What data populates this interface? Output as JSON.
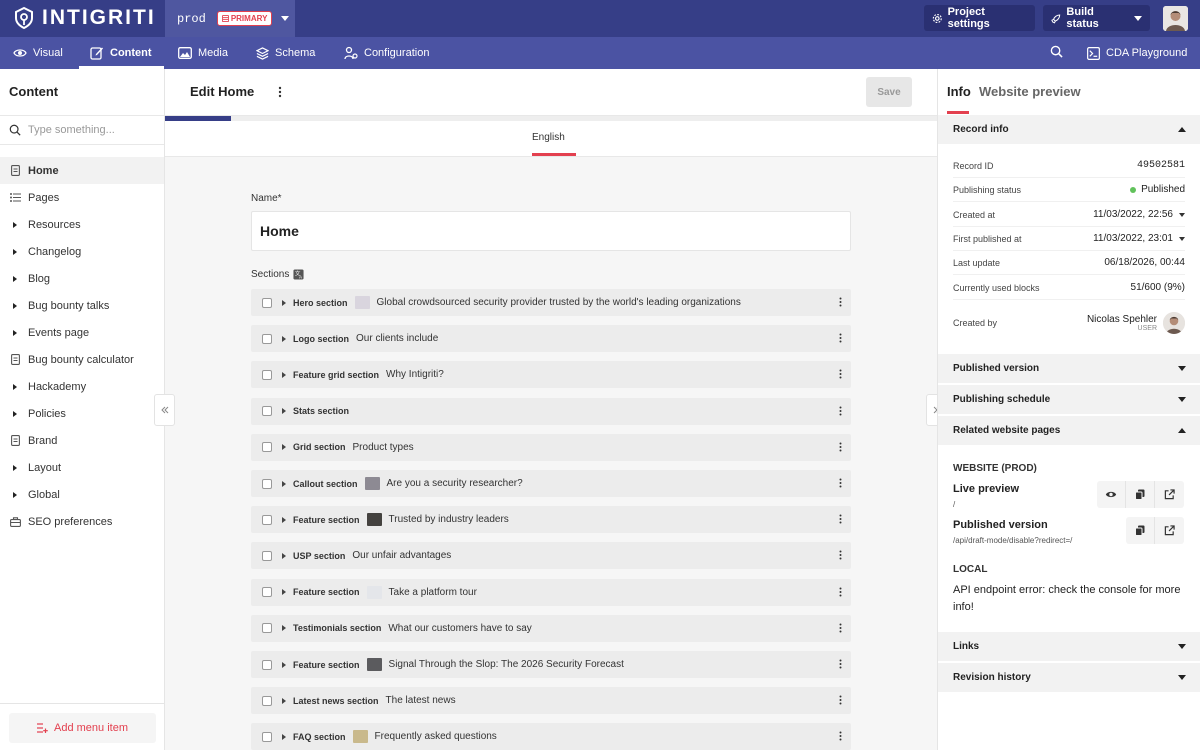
{
  "brand": {
    "name": "INTIGRITI"
  },
  "environment": {
    "name": "prod",
    "badge": "PRIMARY"
  },
  "top_actions": {
    "project_settings": "Project settings",
    "build_status": "Build status"
  },
  "nav": {
    "items": [
      {
        "label": "Visual"
      },
      {
        "label": "Content"
      },
      {
        "label": "Media"
      },
      {
        "label": "Schema"
      },
      {
        "label": "Configuration"
      }
    ],
    "active": "Content",
    "cda_playground": "CDA Playground"
  },
  "sidebar": {
    "title": "Content",
    "search_placeholder": "Type something...",
    "items": [
      {
        "label": "Home",
        "icon": "document-icon"
      },
      {
        "label": "Pages",
        "icon": "list-icon"
      },
      {
        "label": "Resources",
        "icon": "expand-icon"
      },
      {
        "label": "Changelog",
        "icon": "expand-icon"
      },
      {
        "label": "Blog",
        "icon": "expand-icon"
      },
      {
        "label": "Bug bounty talks",
        "icon": "expand-icon"
      },
      {
        "label": "Events page",
        "icon": "expand-icon"
      },
      {
        "label": "Bug bounty calculator",
        "icon": "document-icon"
      },
      {
        "label": "Hackademy",
        "icon": "expand-icon"
      },
      {
        "label": "Policies",
        "icon": "expand-icon"
      },
      {
        "label": "Brand",
        "icon": "document-icon"
      },
      {
        "label": "Layout",
        "icon": "expand-icon"
      },
      {
        "label": "Global",
        "icon": "expand-icon"
      },
      {
        "label": "SEO preferences",
        "icon": "tools-icon"
      }
    ],
    "add_menu_item": "Add menu item"
  },
  "editor": {
    "title": "Edit Home",
    "save": "Save",
    "progress": 0.085,
    "language_tab": "English",
    "name_label": "Name*",
    "name_value": "Home",
    "sections_label": "Sections",
    "sections": [
      {
        "type": "Hero section",
        "title": "Global crowdsourced security provider trusted by the world's leading organizations",
        "thumb": "#d9d5de"
      },
      {
        "type": "Logo section",
        "title": "Our clients include",
        "thumb": ""
      },
      {
        "type": "Feature grid section",
        "title": "Why Intigriti?",
        "thumb": ""
      },
      {
        "type": "Stats section",
        "title": "",
        "thumb": ""
      },
      {
        "type": "Grid section",
        "title": "Product types",
        "thumb": ""
      },
      {
        "type": "Callout section",
        "title": "Are you a security researcher?",
        "thumb": "#8d8a93"
      },
      {
        "type": "Feature section",
        "title": "Trusted by industry leaders",
        "thumb": "#44423f"
      },
      {
        "type": "USP section",
        "title": "Our unfair advantages",
        "thumb": ""
      },
      {
        "type": "Feature section",
        "title": "Take a platform tour",
        "thumb": "#e4e6ea"
      },
      {
        "type": "Testimonials section",
        "title": "What our customers have to say",
        "thumb": ""
      },
      {
        "type": "Feature section",
        "title": "Signal Through the Slop: The 2026 Security Forecast",
        "thumb": "#5b5b5e"
      },
      {
        "type": "Latest news section",
        "title": "The latest news",
        "thumb": ""
      },
      {
        "type": "FAQ section",
        "title": "Frequently asked questions",
        "thumb": "#c9b98c"
      }
    ]
  },
  "info_panel": {
    "tab_info": "Info",
    "tab_preview": "Website preview",
    "record_info": "Record info",
    "rows": [
      {
        "label": "Record ID",
        "value": "49502581"
      },
      {
        "label": "Publishing status",
        "value": "Published"
      },
      {
        "label": "Created at",
        "value": "11/03/2022, 22:56"
      },
      {
        "label": "First published at",
        "value": "11/03/2022, 23:01"
      },
      {
        "label": "Last update",
        "value": "06/18/2026, 00:44"
      },
      {
        "label": "Currently used blocks",
        "value": "51/600 (9%)"
      },
      {
        "label": "Created by",
        "value": "Nicolas Spehler",
        "role": "USER"
      }
    ],
    "published_version": "Published version",
    "publishing_schedule": "Publishing schedule",
    "related_pages": "Related website pages",
    "website_label": "WEBSITE (PROD)",
    "live_preview": "Live preview",
    "live_preview_path": "/",
    "published_version_link": "Published version",
    "published_version_path": "/api/draft-mode/disable?redirect=/",
    "local_label": "LOCAL",
    "local_message": "API endpoint error: check the console for more info!",
    "links": "Links",
    "revision_history": "Revision history"
  },
  "colors": {
    "topbar": "#363e87",
    "navbar": "#4b53a3",
    "accent": "#e3404f",
    "published": "#61c25b"
  }
}
